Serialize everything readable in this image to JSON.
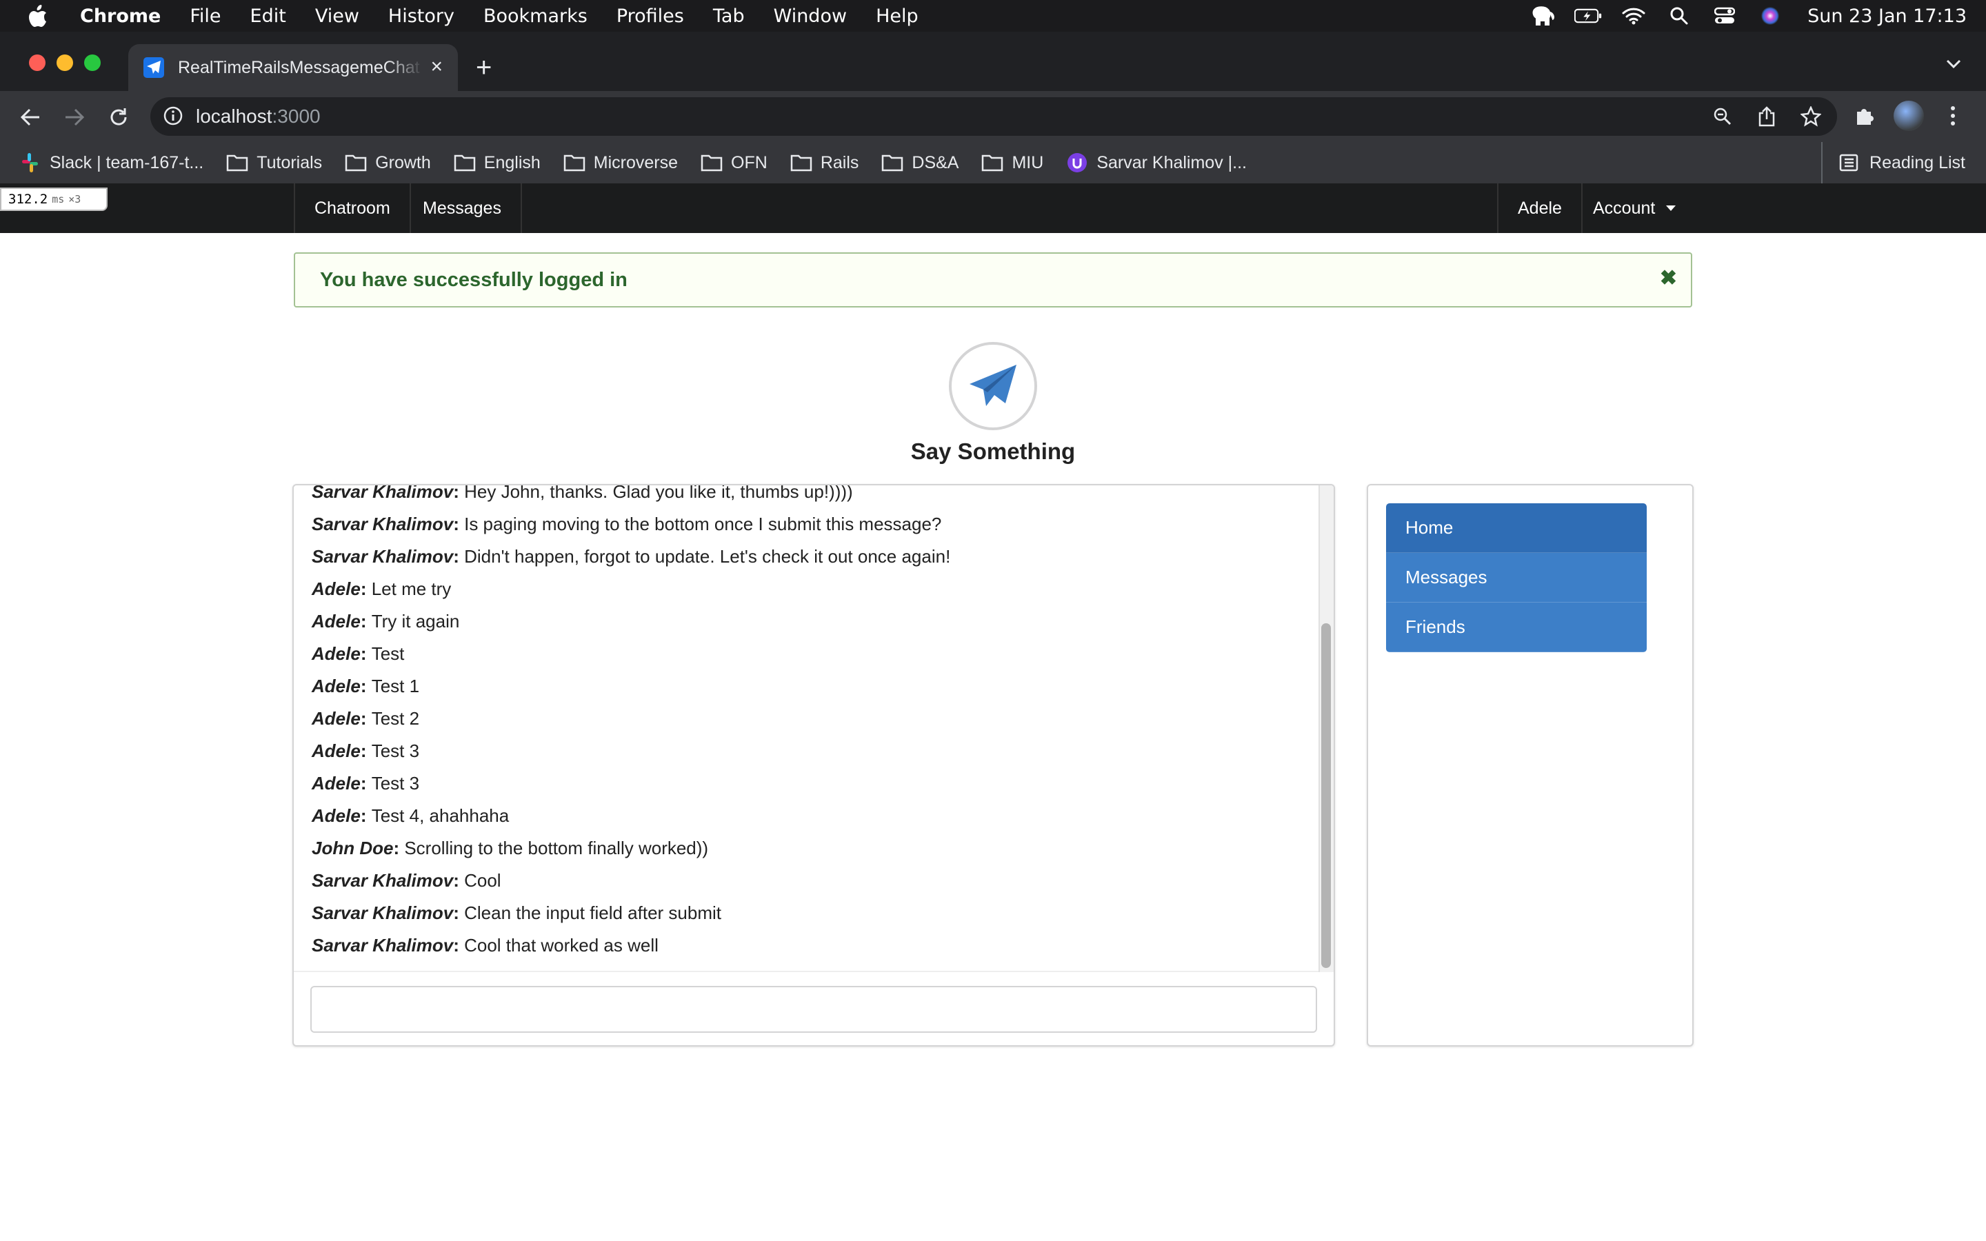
{
  "menubar": {
    "app": "Chrome",
    "items": [
      "File",
      "Edit",
      "View",
      "History",
      "Bookmarks",
      "Profiles",
      "Tab",
      "Window",
      "Help"
    ],
    "clock": "Sun 23 Jan  17:13"
  },
  "browser": {
    "tab_title": "RealTimeRailsMessagemeChat",
    "url_host": "localhost",
    "url_port": ":3000",
    "bookmarks": [
      "Slack | team-167-t...",
      "Tutorials",
      "Growth",
      "English",
      "Microverse",
      "OFN",
      "Rails",
      "DS&A",
      "MIU",
      "Sarvar Khalimov |..."
    ],
    "reading_list": "Reading List"
  },
  "perf_badge": {
    "value": "312.2",
    "unit": "ms",
    "count": "×3"
  },
  "nav": {
    "chatroom": "Chatroom",
    "messages": "Messages",
    "user": "Adele",
    "account": "Account"
  },
  "flash": {
    "text": "You have successfully logged in"
  },
  "heading": "Say Something",
  "messages": [
    {
      "author": "Sarvar Khalimov",
      "text": "Hey John, thanks. Glad you like it, thumbs up!))))"
    },
    {
      "author": "Sarvar Khalimov",
      "text": "Is paging moving to the bottom once I submit this message?"
    },
    {
      "author": "Sarvar Khalimov",
      "text": "Didn't happen, forgot to update. Let's check it out once again!"
    },
    {
      "author": "Adele",
      "text": "Let me try"
    },
    {
      "author": "Adele",
      "text": "Try it again"
    },
    {
      "author": "Adele",
      "text": "Test"
    },
    {
      "author": "Adele",
      "text": "Test 1"
    },
    {
      "author": "Adele",
      "text": "Test 2"
    },
    {
      "author": "Adele",
      "text": "Test 3"
    },
    {
      "author": "Adele",
      "text": "Test 3"
    },
    {
      "author": "Adele",
      "text": "Test 4, ahahhaha"
    },
    {
      "author": "John Doe",
      "text": "Scrolling to the bottom finally worked))"
    },
    {
      "author": "Sarvar Khalimov",
      "text": "Cool"
    },
    {
      "author": "Sarvar Khalimov",
      "text": "Clean the input field after submit"
    },
    {
      "author": "Sarvar Khalimov",
      "text": "Cool that worked as well"
    }
  ],
  "chat_input": {
    "value": "",
    "placeholder": ""
  },
  "side_menu": [
    "Home",
    "Messages",
    "Friends"
  ],
  "colors": {
    "accent": "#3d7fc8",
    "flash_bg": "#fcfff5",
    "flash_text": "#2c662d"
  }
}
